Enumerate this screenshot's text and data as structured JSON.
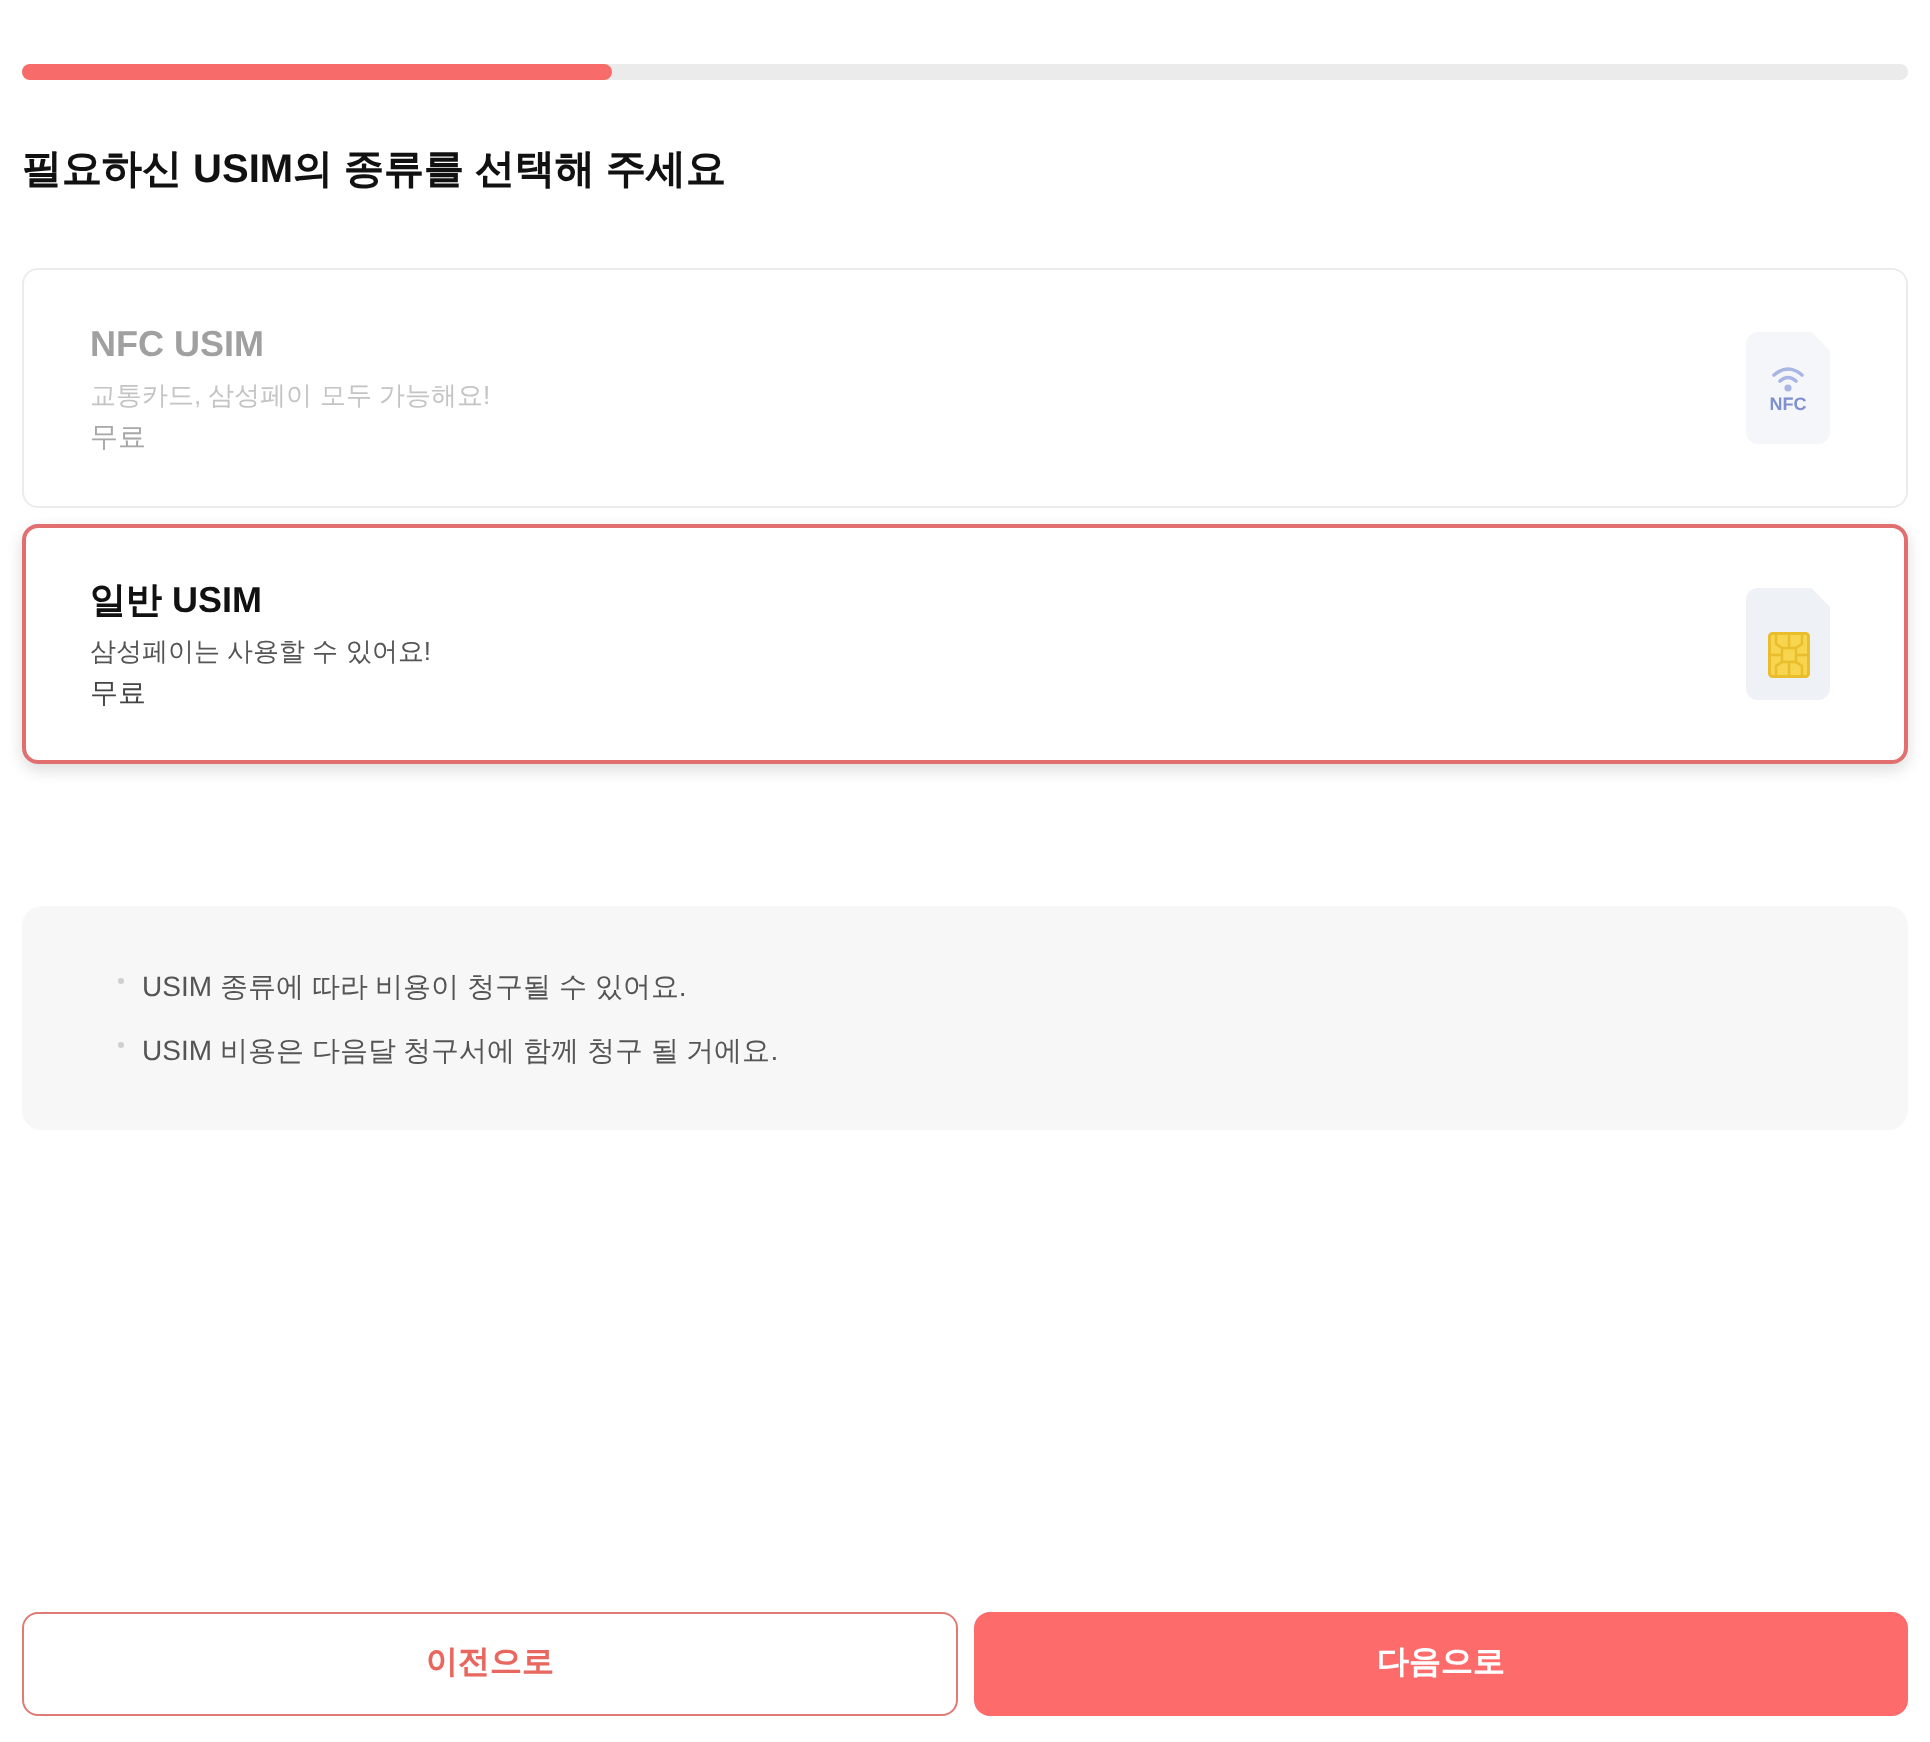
{
  "progress": {
    "level": 0.313
  },
  "title": "필요하신 USIM의 종류를 선택해 주세요",
  "options": [
    {
      "name": "NFC USIM",
      "description": "교통카드, 삼성페이 모두 가능해요!",
      "price": "무료",
      "selected": false,
      "disabled": true,
      "icon": {
        "kind": "nfc",
        "label": "NFC"
      }
    },
    {
      "name": "일반 USIM",
      "description": "삼성페이는 사용할 수 있어요!",
      "price": "무료",
      "selected": true,
      "disabled": false,
      "icon": {
        "kind": "chip"
      }
    }
  ],
  "notices": [
    "USIM 종류에 따라 비용이 청구될 수 있어요.",
    "USIM 비용은 다음달 청구서에 함께 청구 될 거에요."
  ],
  "buttons": [
    {
      "label": "이전으로",
      "kind": "secondary"
    },
    {
      "label": "다음으로",
      "kind": "primary"
    }
  ]
}
